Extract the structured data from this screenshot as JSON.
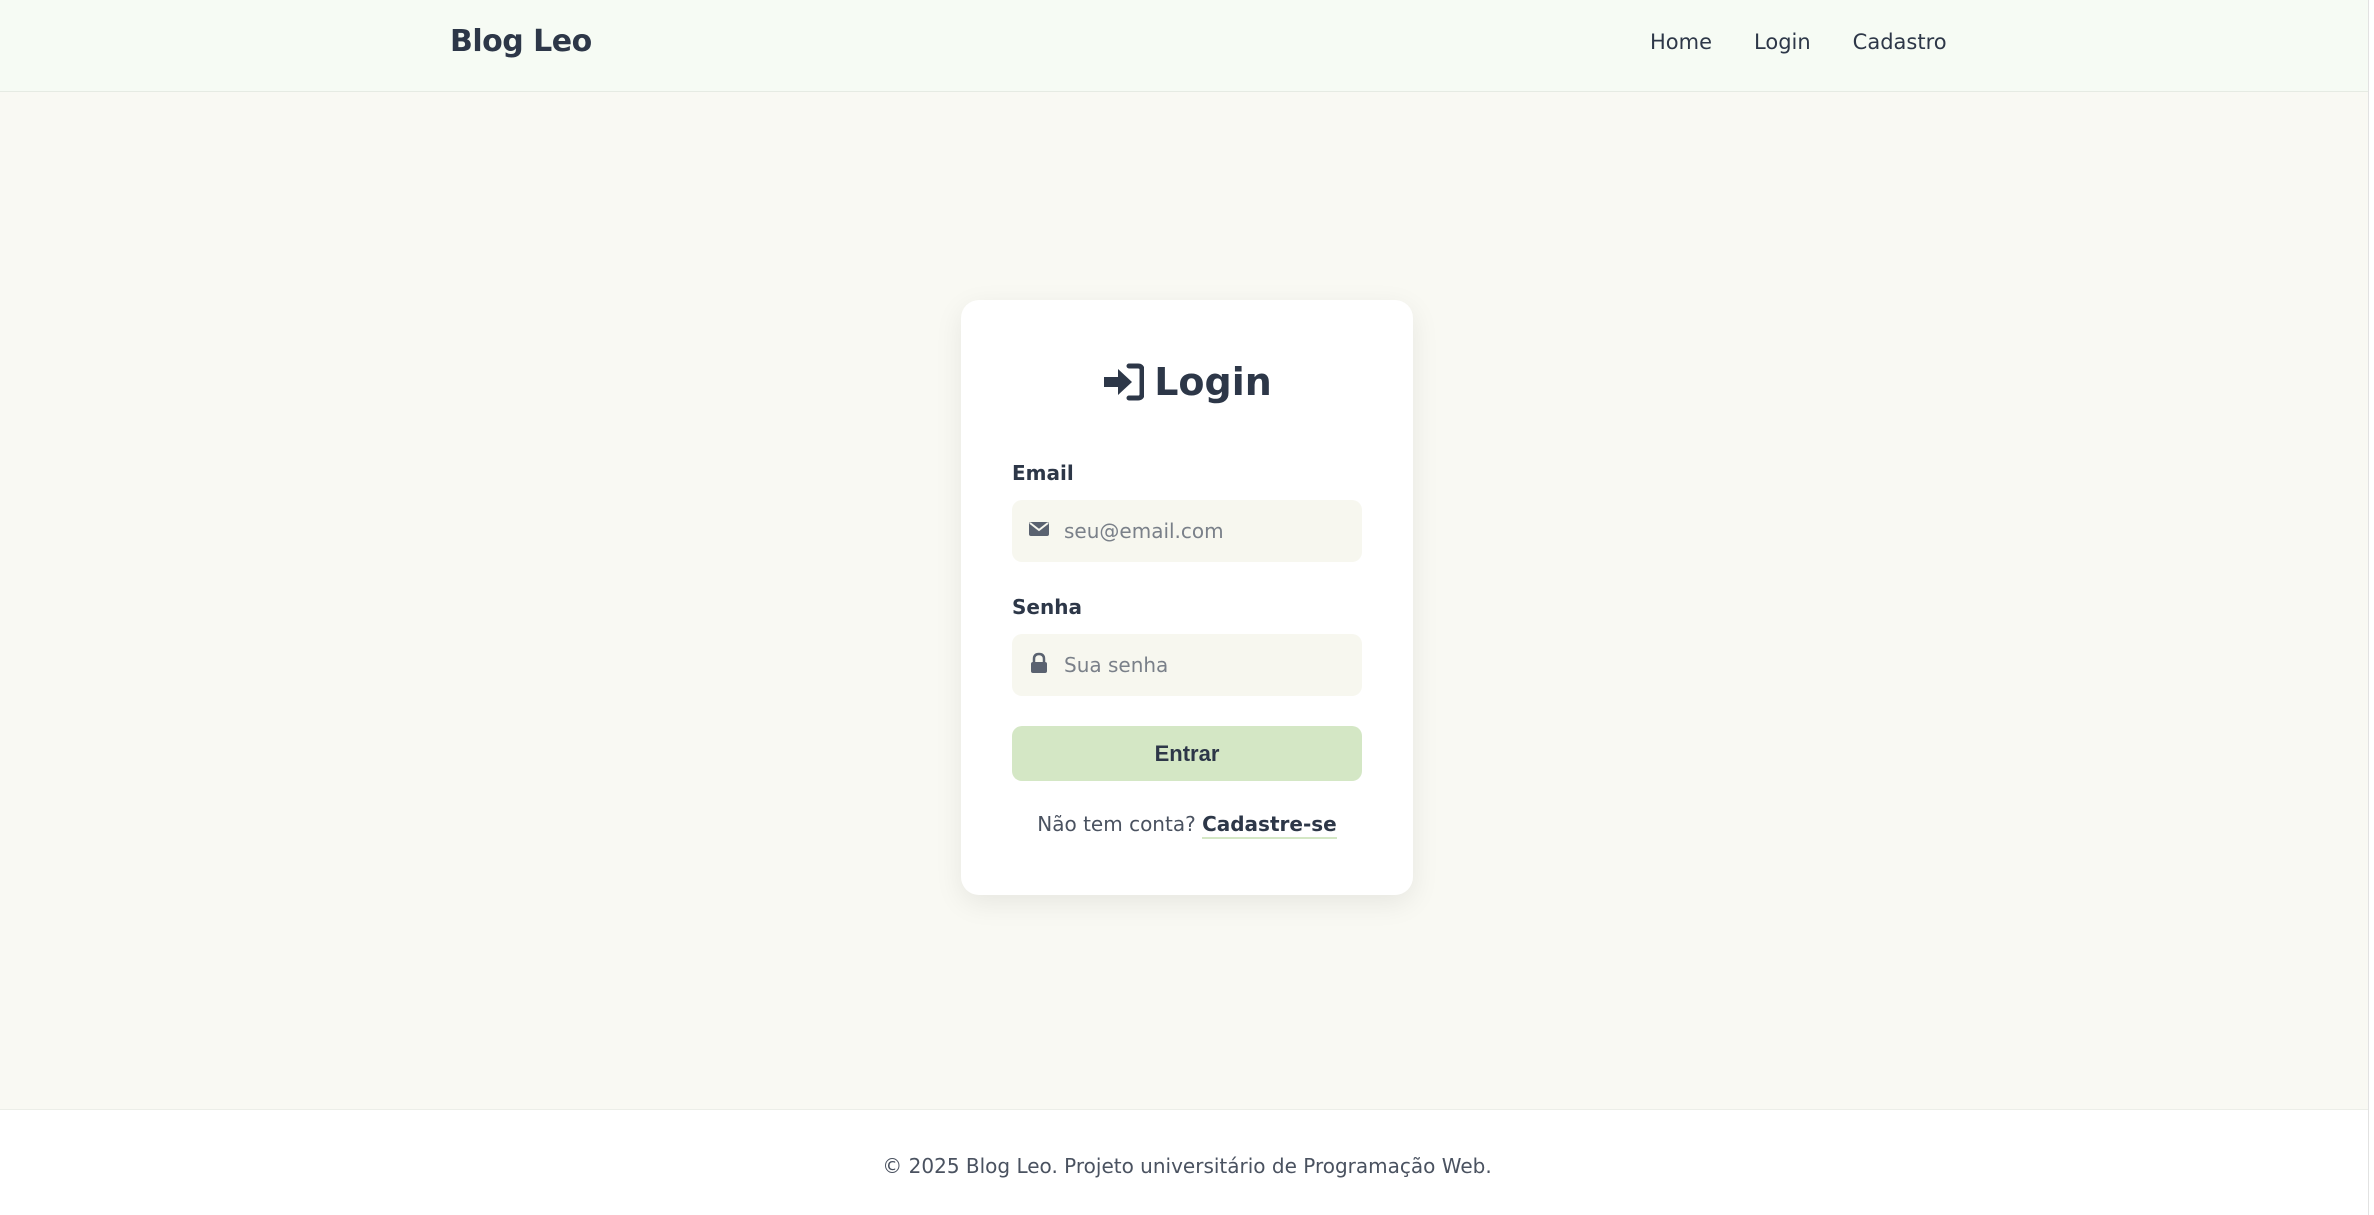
{
  "navbar": {
    "brand": "Blog Leo",
    "links": [
      "Home",
      "Login",
      "Cadastro"
    ]
  },
  "login_card": {
    "title": "Login",
    "title_icon": "sign-in-icon",
    "email": {
      "label": "Email",
      "placeholder": "seu@email.com",
      "value": "",
      "icon": "envelope-icon"
    },
    "password": {
      "label": "Senha",
      "placeholder": "Sua senha",
      "value": "",
      "icon": "lock-icon"
    },
    "submit_label": "Entrar",
    "signup_prompt": "Não tem conta?",
    "signup_link": "Cadastre-se"
  },
  "footer": {
    "text": "© 2025 Blog Leo. Projeto universitário de Programação Web."
  },
  "colors": {
    "accent": "#d4e7c5",
    "text": "#2d3748",
    "background": "#f9f9f3",
    "navbar_bg": "#f6fbf4"
  }
}
